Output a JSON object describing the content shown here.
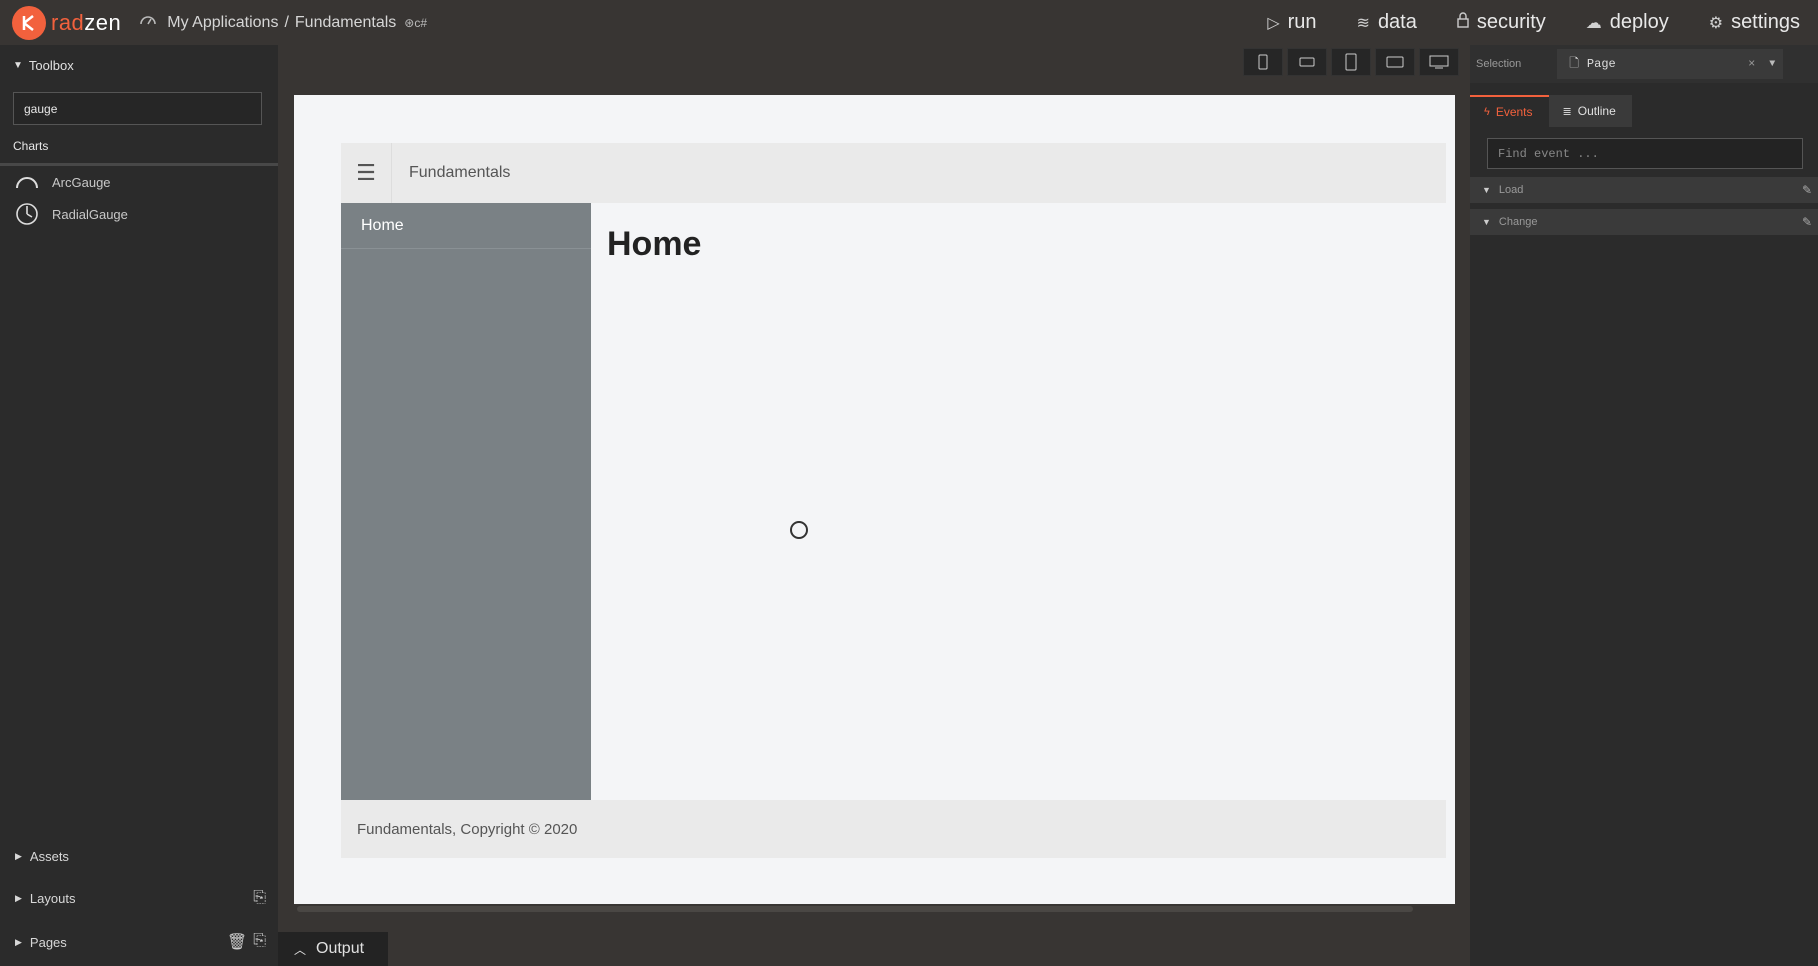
{
  "app": {
    "brand_rad": "rad",
    "brand_zen": "zen",
    "breadcrumb_root": "My Applications",
    "breadcrumb_sep": "/",
    "breadcrumb_project": "Fundamentals",
    "lang": "c#"
  },
  "topnav": {
    "run": "run",
    "data": "data",
    "security": "security",
    "deploy": "deploy",
    "settings": "settings"
  },
  "toolbox": {
    "title": "Toolbox",
    "search_value": "gauge",
    "category": "Charts",
    "items": [
      {
        "label": "ArcGauge",
        "icon": "arc-gauge-icon"
      },
      {
        "label": "RadialGauge",
        "icon": "radial-gauge-icon"
      }
    ],
    "assets": "Assets",
    "layouts": "Layouts",
    "pages": "Pages"
  },
  "canvas": {
    "header_title": "Fundamentals",
    "nav_item": "Home",
    "page_heading": "Home",
    "footer": "Fundamentals, Copyright © 2020"
  },
  "output": {
    "label": "Output"
  },
  "properties": {
    "selection_label": "Selection",
    "selection_value": "Page",
    "tab_events": "Events",
    "tab_outline": "Outline",
    "find_event_placeholder": "Find event ...",
    "events": [
      "Load",
      "Change"
    ]
  },
  "colors": {
    "brand": "#f2613d",
    "background": "#383533",
    "panel": "#2b2b2b",
    "canvas_sidebar": "#7a8185"
  }
}
